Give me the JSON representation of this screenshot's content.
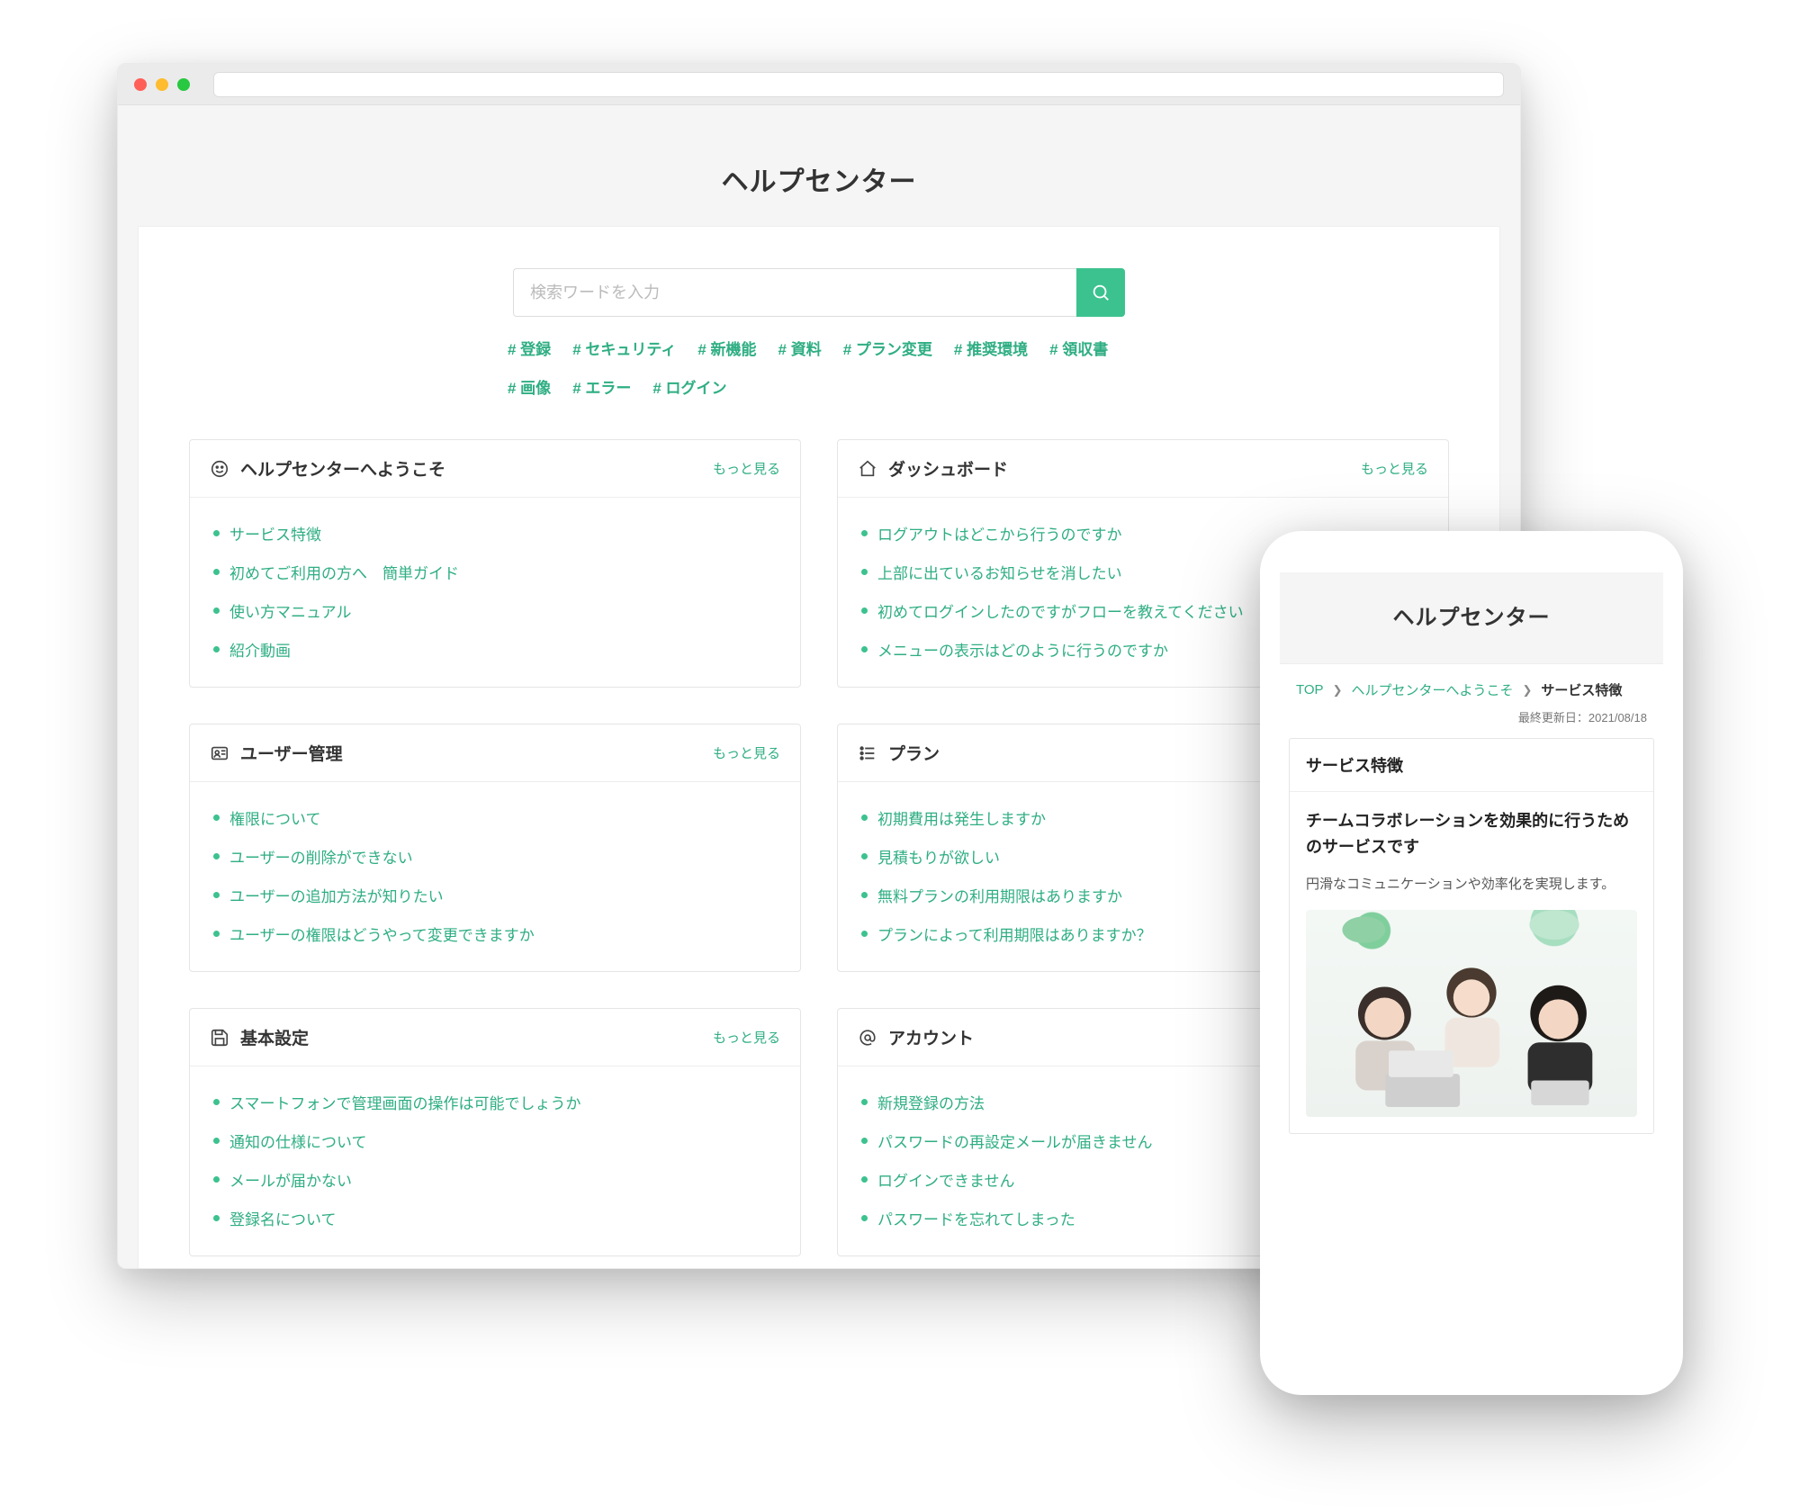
{
  "colors": {
    "accent": "#3cc28f",
    "link": "#2fae83"
  },
  "hero": {
    "title": "ヘルプセンター"
  },
  "search": {
    "placeholder": "検索ワードを入力"
  },
  "tags": [
    "# 登録",
    "# セキュリティ",
    "# 新機能",
    "# 資料",
    "# プラン変更",
    "# 推奨環境",
    "# 領収書",
    "# 画像",
    "# エラー",
    "# ログイン"
  ],
  "more_label": "もっと見る",
  "cards": [
    {
      "icon": "smile",
      "title": "ヘルプセンターへようこそ",
      "items": [
        "サービス特徴",
        "初めてご利用の方へ　簡単ガイド",
        "使い方マニュアル",
        "紹介動画"
      ]
    },
    {
      "icon": "home",
      "title": "ダッシュボード",
      "items": [
        "ログアウトはどこから行うのですか",
        "上部に出ているお知らせを消したい",
        "初めてログインしたのですがフローを教えてください",
        "メニューの表示はどのように行うのですか"
      ]
    },
    {
      "icon": "idcard",
      "title": "ユーザー管理",
      "items": [
        "権限について",
        "ユーザーの削除ができない",
        "ユーザーの追加方法が知りたい",
        "ユーザーの権限はどうやって変更できますか"
      ]
    },
    {
      "icon": "list",
      "title": "プラン",
      "items": [
        "初期費用は発生しますか",
        "見積もりが欲しい",
        "無料プランの利用期限はありますか",
        "プランによって利用期限はありますか？"
      ]
    },
    {
      "icon": "save",
      "title": "基本設定",
      "items": [
        "スマートフォンで管理画面の操作は可能でしょうか",
        "通知の仕様について",
        "メールが届かない",
        "登録名について"
      ]
    },
    {
      "icon": "at",
      "title": "アカウント",
      "items": [
        "新規登録の方法",
        "パスワードの再設定メールが届きません",
        "ログインできません",
        "パスワードを忘れてしまった"
      ]
    }
  ],
  "mobile": {
    "title": "ヘルプセンター",
    "crumbs": {
      "top": "TOP",
      "mid": "ヘルプセンターへようこそ",
      "cur": "サービス特徴"
    },
    "updated": "最終更新日：2021/08/18",
    "article": {
      "title": "サービス特徴",
      "heading": "チームコラボレーションを効果的に行うためのサービスです",
      "body": "円滑なコミュニケーションや効率化を実現します。"
    }
  }
}
